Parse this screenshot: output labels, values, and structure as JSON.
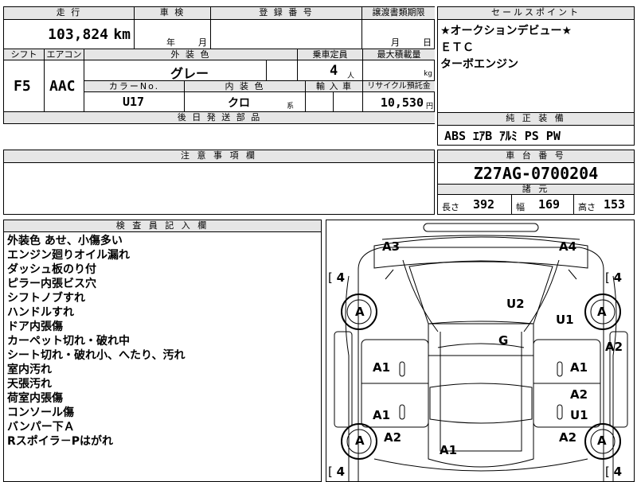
{
  "top": {
    "mileage_label": "走 行",
    "mileage_value": "103,824",
    "mileage_unit": "km",
    "inspection_label": "車 検",
    "inspection_year": "年",
    "inspection_month": "月",
    "registration_label": "登 録 番 号",
    "transfer_label": "譲渡書類期限",
    "transfer_month": "月",
    "transfer_day": "日",
    "shift_label": "シフト",
    "shift_value": "F5",
    "aircon_label": "エアコン",
    "aircon_value": "AAC",
    "exterior_label": "外 装 色",
    "exterior_value": "グレー",
    "capacity_label": "乗車定員",
    "capacity_value": "4",
    "capacity_unit": "人",
    "maxload_label": "最大積載量",
    "maxload_unit": "kg",
    "colorno_label": "カラーNo.",
    "colorno_value": "U17",
    "interior_label": "内 装 色",
    "interior_value": "クロ",
    "interior_suffix": "系",
    "import_label": "輸 入 車",
    "recycle_label": "リサイクル預託金",
    "recycle_value": "10,530",
    "recycle_unit": "円",
    "later_parts_label": "後 日 発 送 部 品"
  },
  "sales": {
    "label": "セールスポイント",
    "lines": [
      "★オークションデビュー★",
      "ＥＴＣ",
      "ターボエンジン"
    ]
  },
  "equipment": {
    "label": "純 正 装 備",
    "value": "ABS ｴｱB ｱﾙﾐ PS PW"
  },
  "caution": {
    "label": "注 意 事 項 欄"
  },
  "chassis": {
    "label": "車 台 番 号",
    "value": "Z27AG-0700204",
    "specs_label": "諸 元",
    "length_label": "長さ",
    "length_value": "392",
    "width_label": "幅",
    "width_value": "169",
    "height_label": "高さ",
    "height_value": "153"
  },
  "inspector": {
    "label": "検 査 員 記 入 欄",
    "notes": [
      "外装色 あせ、小傷多い",
      "エンジン廻りオイル漏れ",
      "ダッシュ板のり付",
      "ピラー内張ビス穴",
      "シフトノブすれ",
      "ハンドルすれ",
      "ドア内張傷",
      "カーペット切れ・破れ中",
      "シート切れ・破れ小、へたり、汚れ",
      "室内汚れ",
      "天張汚れ",
      "荷室内張傷",
      "コンソール傷",
      "バンパー下Ａ",
      "Rスポイラ－Pはがれ"
    ]
  },
  "diagram": {
    "tire_depth": "4",
    "tire_bracket_open": "[",
    "labels": {
      "a3": "A3",
      "a4": "A4",
      "u2": "U2",
      "u1_top": "U1",
      "g": "G",
      "a2_right": "A2",
      "a1_left_mid": "A1",
      "a1_right_mid": "A1",
      "a2_right_mid": "A2",
      "a1_left_low": "A1",
      "u1_right_low": "U1",
      "a2_left_bottom": "A2",
      "a2_right_bottom": "A2",
      "a1_bottom": "A1",
      "tire_fl": "A",
      "tire_fr": "A",
      "tire_rl": "A",
      "tire_rr": "A"
    }
  }
}
